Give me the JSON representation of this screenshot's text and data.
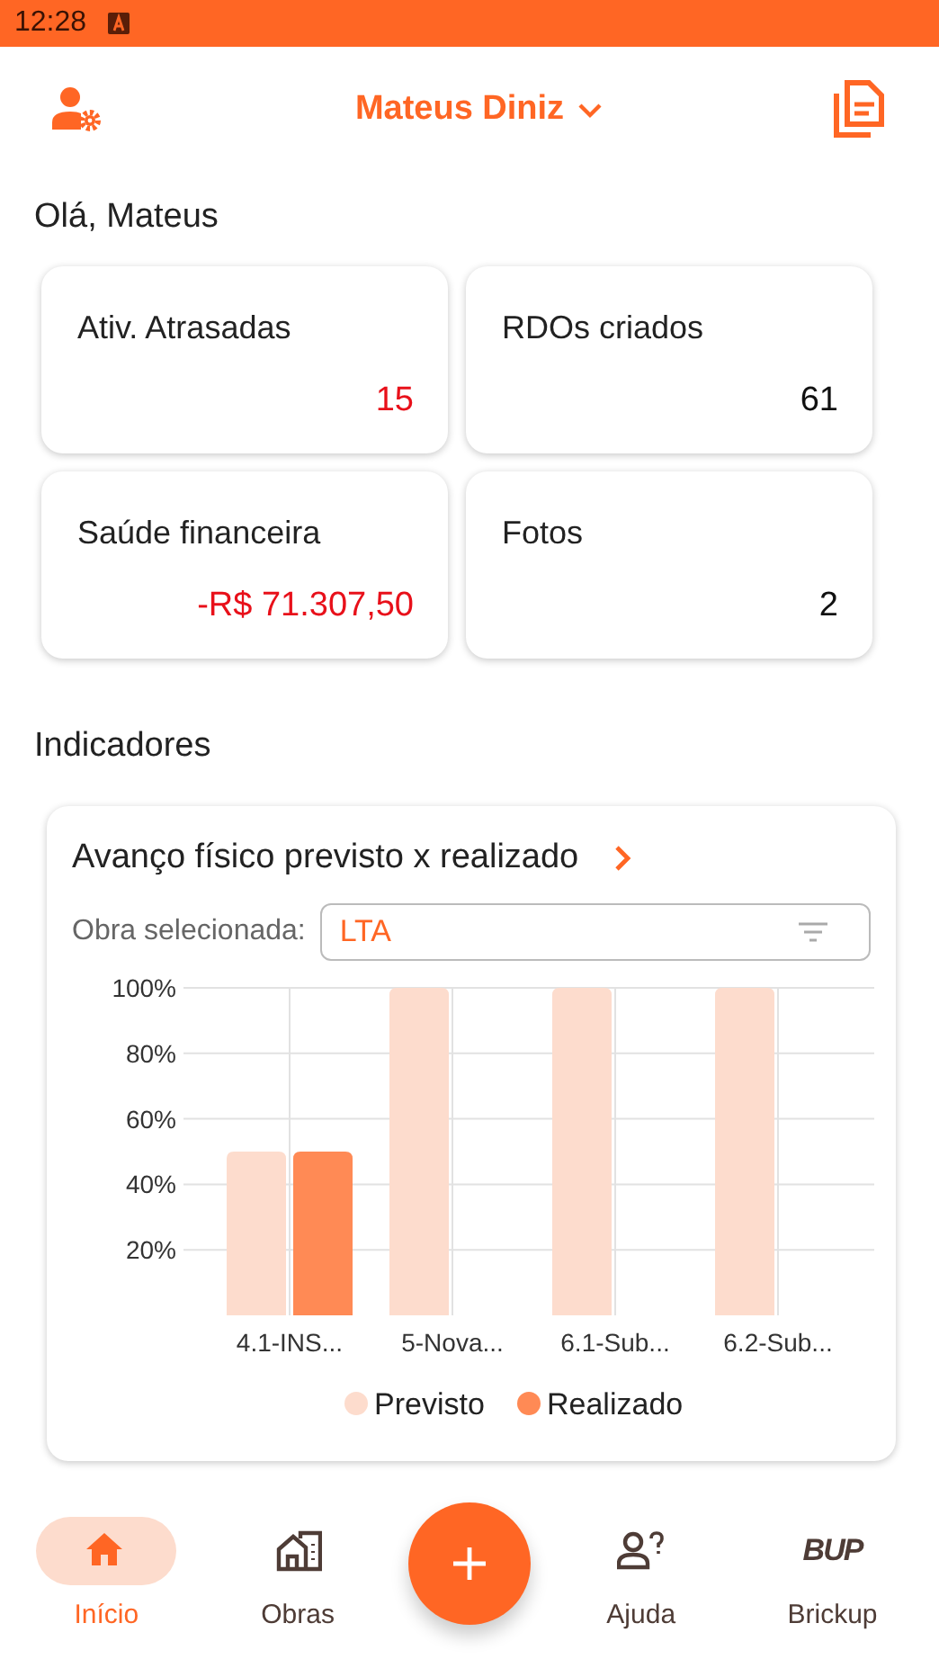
{
  "status_bar": {
    "time": "12:28"
  },
  "header": {
    "user_name": "Mateus Diniz"
  },
  "greeting": "Olá, Mateus",
  "stats": [
    {
      "label": "Ativ. Atrasadas",
      "value": "15",
      "kind": "alert"
    },
    {
      "label": "RDOs criados",
      "value": "61",
      "kind": "normal"
    },
    {
      "label": "Saúde financeira",
      "value": "-R$ 71.307,50",
      "kind": "alert"
    },
    {
      "label": "Fotos",
      "value": "2",
      "kind": "normal"
    }
  ],
  "indicators": {
    "title": "Indicadores",
    "card": {
      "title": "Avanço físico previsto x realizado",
      "filter_label": "Obra selecionada:",
      "filter_value": "LTA",
      "chart_data": {
        "type": "bar",
        "categories": [
          "4.1-INS...",
          "5-Nova...",
          "6.1-Sub...",
          "6.2-Sub..."
        ],
        "series": [
          {
            "name": "Previsto",
            "color": "#fddccd",
            "values": [
              50,
              100,
              100,
              100
            ]
          },
          {
            "name": "Realizado",
            "color": "#ff8a55",
            "values": [
              50,
              0,
              0,
              0
            ]
          }
        ],
        "grid": true,
        "legend": true,
        "ylim": [
          0,
          100
        ],
        "yticks": [
          {
            "value": 20,
            "label": "20%"
          },
          {
            "value": 40,
            "label": "40%"
          },
          {
            "value": 60,
            "label": "60%"
          },
          {
            "value": 80,
            "label": "80%"
          },
          {
            "value": 100,
            "label": "100%"
          }
        ]
      }
    }
  },
  "nav": [
    {
      "label": "Início",
      "kind": "home",
      "selected": true
    },
    {
      "label": "Obras",
      "kind": "buildings",
      "selected": false
    },
    {
      "kind": "fab"
    },
    {
      "label": "Ajuda",
      "kind": "help",
      "selected": false
    },
    {
      "label": "Brickup",
      "kind": "logo",
      "logo_text": "BUP",
      "selected": false
    }
  ]
}
